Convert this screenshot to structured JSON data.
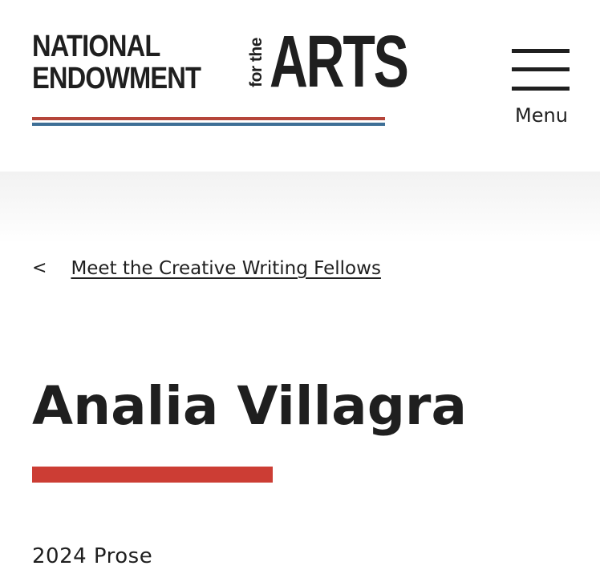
{
  "header": {
    "logo": {
      "line1": "NATIONAL",
      "line2": "ENDOWMENT",
      "for_the": "for the",
      "arts": "ARTS"
    },
    "menu_label": "Menu"
  },
  "breadcrumb": {
    "chevron": "<",
    "link_label": "Meet the Creative Writing Fellows"
  },
  "main": {
    "title": "Analia Villagra",
    "subtitle": "2024 Prose"
  },
  "colors": {
    "text": "#1f1f1f",
    "stripe_red": "#b5453a",
    "stripe_blue": "#3e6f96",
    "accent_red": "#cc3d34"
  }
}
